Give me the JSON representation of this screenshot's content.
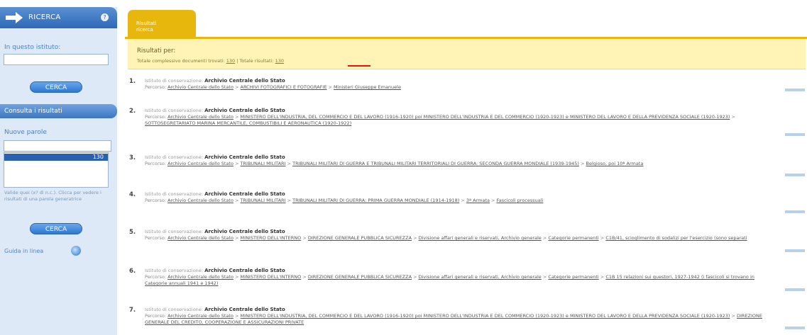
{
  "sidebar": {
    "header_title": "RICERCA",
    "help_icon": "?",
    "search_label": "In questo istituto:",
    "search_value": "",
    "search_button": "CERCA",
    "refine_bar": "Consulta i risultati",
    "keywords_label": "Nuove parole",
    "keywords_value": "",
    "list_selected": "130",
    "help_text": "Valide quei (x? di n.c.). Clicca per vedere i risultati di una parola generatrice",
    "search_button2": "CERCA",
    "help_link": "Guida in linea"
  },
  "main": {
    "tab_line1": "Risultati",
    "tab_line2": "ricerca",
    "results_title": "Risultati per:",
    "totals_prefix": "Totale complessivo documenti trovati:",
    "totals_count": "130",
    "totals_sep": "| Totale risultati:",
    "totals_count2": "130",
    "results": [
      {
        "num": "1.",
        "label": "Istituto di conservazione:",
        "institute": "Archivio Centrale dello Stato",
        "path_label": "Percorso:",
        "path": [
          "Archivio Centrale dello Stato",
          "ARCHIVI FOTOGRAFICI E FOTOGRAFIE",
          "Ministeri Giuseppe Emanuele"
        ]
      },
      {
        "num": "2.",
        "label": "Istituto di conservazione:",
        "institute": "Archivio Centrale dello Stato",
        "path_label": "Percorso:",
        "path": [
          "Archivio Centrale dello Stato",
          "MINISTERO DELL'INDUSTRIA, DEL COMMERCIO E DEL LAVORO (1916-1920) poi MINISTERO DELL'INDUSTRIA E DEL COMMERCIO (1920-1923) e MINISTERO DEL LAVORO E DELLA PREVIDENZA SOCIALE (1920-1923)",
          "SOTTOSEGRETARIATO MARINA MERCANTILE, COMBUSTIBILI E AERONAUTICA (1920-1922)"
        ]
      },
      {
        "num": "3.",
        "label": "Istituto di conservazione:",
        "institute": "Archivio Centrale dello Stato",
        "path_label": "Percorso:",
        "path": [
          "Archivio Centrale dello Stato",
          "TRIBUNALI MILITARI",
          "TRIBUNALI MILITARI DI GUERRA E TRIBUNALI MILITARI TERRITORIALI DI GUERRA: SECONDA GUERRA MONDIALE (1939-1945)",
          "Belgioso, poi 10ª Armata"
        ]
      },
      {
        "num": "4.",
        "label": "Istituto di conservazione:",
        "institute": "Archivio Centrale dello Stato",
        "path_label": "Percorso:",
        "path": [
          "Archivio Centrale dello Stato",
          "TRIBUNALI MILITARI",
          "TRIBUNALI MILITARI DI GUERRA: PRIMA GUERRA MONDIALE (1914-1918)",
          "3ª Armata",
          "Fascicoli processuali"
        ]
      },
      {
        "num": "5.",
        "label": "Istituto di conservazione:",
        "institute": "Archivio Centrale dello Stato",
        "path_label": "Percorso:",
        "path": [
          "Archivio Centrale dello Stato",
          "MINISTERO DELL'INTERNO",
          "DIREZIONE GENERALE PUBBLICA SICUREZZA",
          "Divisione affari generali e riservati, Archivio generale",
          "Categorie permanenti",
          "C1B/41, scioglimento di sodalizi per l'esercizio (sono separati"
        ]
      },
      {
        "num": "6.",
        "label": "Istituto di conservazione:",
        "institute": "Archivio Centrale dello Stato",
        "path_label": "Percorso:",
        "path": [
          "Archivio Centrale dello Stato",
          "MINISTERO DELL'INTERNO",
          "DIREZIONE GENERALE PUBBLICA SICUREZZA",
          "Divisione affari generali e riservati, Archivio generale",
          "Categorie permanenti",
          "C1B 15 relazioni sui questori, 1927-1942 (i fascicoli si trovano in Categorie annuali 1941 e 1942)"
        ]
      },
      {
        "num": "7.",
        "label": "Istituto di conservazione:",
        "institute": "Archivio Centrale dello Stato",
        "path_label": "Percorso:",
        "path": [
          "Archivio Centrale dello Stato",
          "MINISTERO DELL'INDUSTRIA, DEL COMMERCIO E DEL LAVORO (1916-1920) poi MINISTERO DELL'INDUSTRIA E DEL COMMERCIO (1920-1923) e MINISTERO DEL LAVORO E DELLA PREVIDENZA SOCIALE (1920-1923)",
          "DIREZIONE GENERALE DEL CREDITO, COOPERAZIONE E ASSICURAZIONI PRIVATE"
        ]
      }
    ]
  },
  "colors": {
    "sidebar_blue": "#2f69b6",
    "panel_yellow": "#fff3b5",
    "tab_yellow": "#e8b70e",
    "highlight_red": "#e11111"
  },
  "icons": [
    "arrow-right-icon",
    "help-icon",
    "globe-icon"
  ]
}
